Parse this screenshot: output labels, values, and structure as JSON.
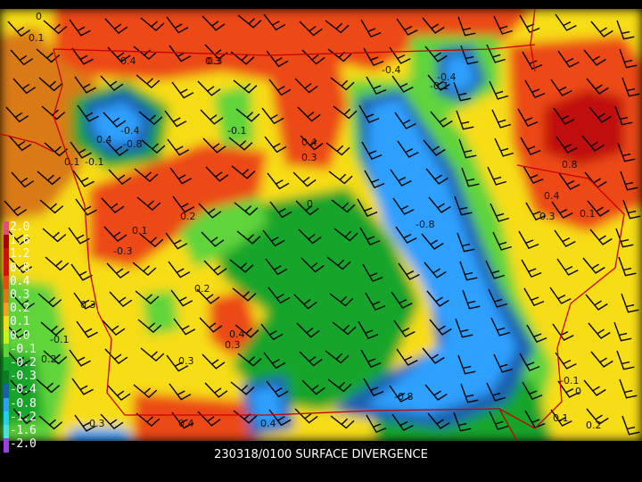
{
  "caption": {
    "date_time": "230318/0100",
    "field_name": "SURFACE DIVERGENCE"
  },
  "legend": {
    "entries": [
      {
        "label": "2.0",
        "color": "#e54e7a"
      },
      {
        "label": "1.6",
        "color": "#a80000"
      },
      {
        "label": "1.2",
        "color": "#cf1010"
      },
      {
        "label": "0.8",
        "color": "#d40f0f"
      },
      {
        "label": "0.4",
        "color": "#ec4a12"
      },
      {
        "label": "0.3",
        "color": "#d97a14"
      },
      {
        "label": "0.2",
        "color": "#f0a020"
      },
      {
        "label": "0.1",
        "color": "#f7dd19"
      },
      {
        "label": "0.0",
        "color": "#c6f21c"
      },
      {
        "label": "-0.1",
        "color": "#5ed43a"
      },
      {
        "label": "-0.2",
        "color": "#16a52a"
      },
      {
        "label": "-0.3",
        "color": "#0b7a2a"
      },
      {
        "label": "-0.4",
        "color": "#1a5eb0"
      },
      {
        "label": "-0.8",
        "color": "#2ea0ff"
      },
      {
        "label": "-1.2",
        "color": "#1fd0f0"
      },
      {
        "label": "-1.6",
        "color": "#48e0e0"
      },
      {
        "label": "-2.0",
        "color": "#9a40e0"
      }
    ]
  },
  "contour_labels": [
    "0",
    "0.1",
    "0.4",
    "0.3",
    "0.4",
    "-0.8",
    "-0.4",
    "-0.1",
    "0.4",
    "0.3",
    "-0.1",
    "0.1",
    "-0.1",
    "0",
    "0.2",
    "0.1",
    "0.2",
    "0.3",
    "-0.8",
    "-0.8",
    "-0.4",
    "0.4",
    "-0.3",
    "0.4",
    "-0.4",
    "0.1",
    "0.2",
    "-0.1",
    "0.1",
    "0",
    "0.3",
    "0.3",
    "-0.1",
    "0.2",
    "0.4",
    "0.3",
    "-0.3",
    "0.8",
    "0.4",
    "0.3"
  ]
}
